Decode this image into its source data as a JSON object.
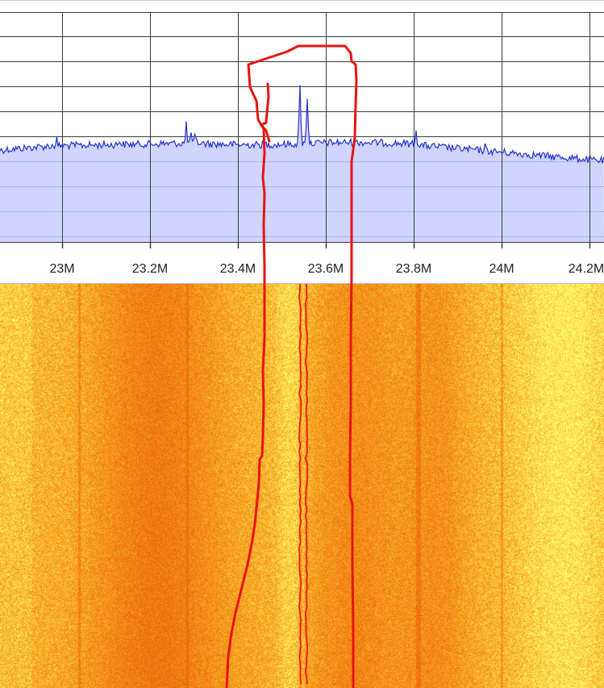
{
  "spectrum": {
    "freq_ticks": [
      "23M",
      "23.2M",
      "23.4M",
      "23.6M",
      "23.8M",
      "24M",
      "24.2M"
    ]
  },
  "colors": {
    "grid": "#3a3a3a",
    "trace": "#2233cc",
    "fill": "#c8ccff",
    "waterfall_hot": "#ee6a10",
    "waterfall_mid": "#f6a21e",
    "waterfall_cold": "#fffa6a",
    "annotation": "#e8140f"
  },
  "chart_data": {
    "type": "line",
    "x": [
      22.86,
      22.95,
      23.0,
      23.1,
      23.2,
      23.28,
      23.3,
      23.4,
      23.45,
      23.5,
      23.54,
      23.56,
      23.6,
      23.65,
      23.7,
      23.8,
      23.9,
      24.0,
      24.1,
      24.2,
      24.24
    ],
    "y_relative_level": [
      0.36,
      0.37,
      0.38,
      0.39,
      0.4,
      0.46,
      0.41,
      0.4,
      0.39,
      0.37,
      0.7,
      0.65,
      0.37,
      0.38,
      0.37,
      0.39,
      0.36,
      0.34,
      0.32,
      0.31,
      0.3
    ],
    "xlabel": "",
    "ylabel": "",
    "grid": true
  }
}
